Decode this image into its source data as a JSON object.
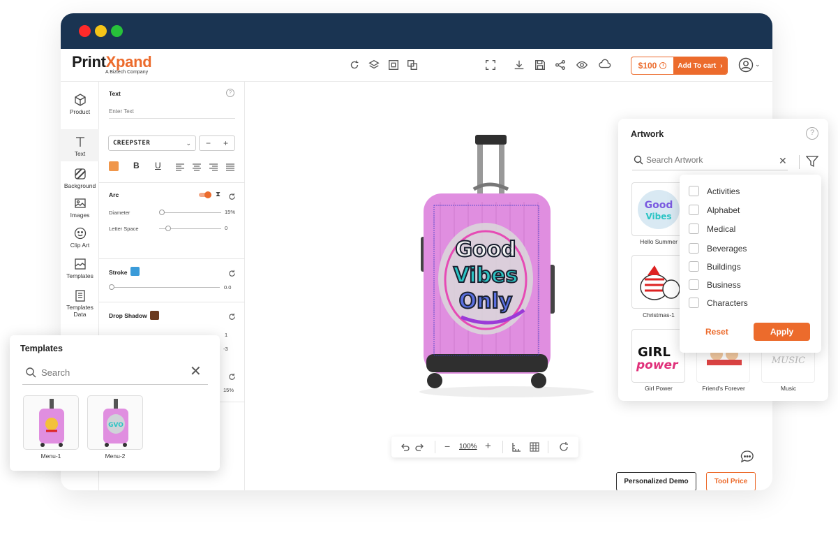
{
  "brand": {
    "name_part1": "Print",
    "name_part2": "Xpand",
    "tagline": "A Biztech Company"
  },
  "topbar": {
    "price": "$100",
    "add_to_cart": "Add To cart"
  },
  "sidebar": {
    "items": [
      {
        "label": "Product",
        "icon": "cube-icon"
      },
      {
        "label": "Text",
        "icon": "text-icon"
      },
      {
        "label": "Background",
        "icon": "background-icon"
      },
      {
        "label": "Images",
        "icon": "image-icon"
      },
      {
        "label": "Clip Art",
        "icon": "smiley-icon"
      },
      {
        "label": "Templates",
        "icon": "templates-icon"
      },
      {
        "label": "Templates Data",
        "icon": "clipboard-icon"
      }
    ]
  },
  "props": {
    "text_title": "Text",
    "text_placeholder": "Enter Text",
    "font_name": "CREEPSTER",
    "text_color": "#f0964a",
    "arc_title": "Arc",
    "diameter_label": "Diameter",
    "diameter_value": "15%",
    "diameter_level": 0.0,
    "letter_space_label": "Letter Space",
    "letter_space_value": "0",
    "letter_space_level": 0.15,
    "stroke_title": "Stroke",
    "stroke_color": "#3a9bd9",
    "stroke_value": "0.0",
    "drop_shadow_title": "Drop Shadow",
    "drop_shadow_color": "#6b3a1e",
    "shadow_val1": "1",
    "shadow_val2": "-3",
    "shadow_val3": "15%"
  },
  "canvas": {
    "design_text": "Good Vibes Only",
    "zoom": "100%",
    "personalized_demo": "Personalized Demo",
    "tool_price": "Tool Price"
  },
  "artwork": {
    "title": "Artwork",
    "search_placeholder": "Search Artwork",
    "items": [
      "Hello Summer",
      "Christmas-1",
      "Girl Power",
      "Friend's Forever",
      "Music"
    ],
    "girl_text1": "GIRL",
    "girl_text2": "power",
    "music_text": "MUSIC"
  },
  "filter": {
    "options": [
      "Activities",
      "Alphabet",
      "Medical",
      "Beverages",
      "Buildings",
      "Business",
      "Characters"
    ],
    "reset": "Reset",
    "apply": "Apply"
  },
  "templates": {
    "title": "Templates",
    "search_placeholder": "Search",
    "items": [
      "Menu-1",
      "Menu-2"
    ]
  },
  "colors": {
    "accent": "#ec6b2c",
    "titlebar": "#1a3452",
    "suitcase": "#e08ee0"
  }
}
